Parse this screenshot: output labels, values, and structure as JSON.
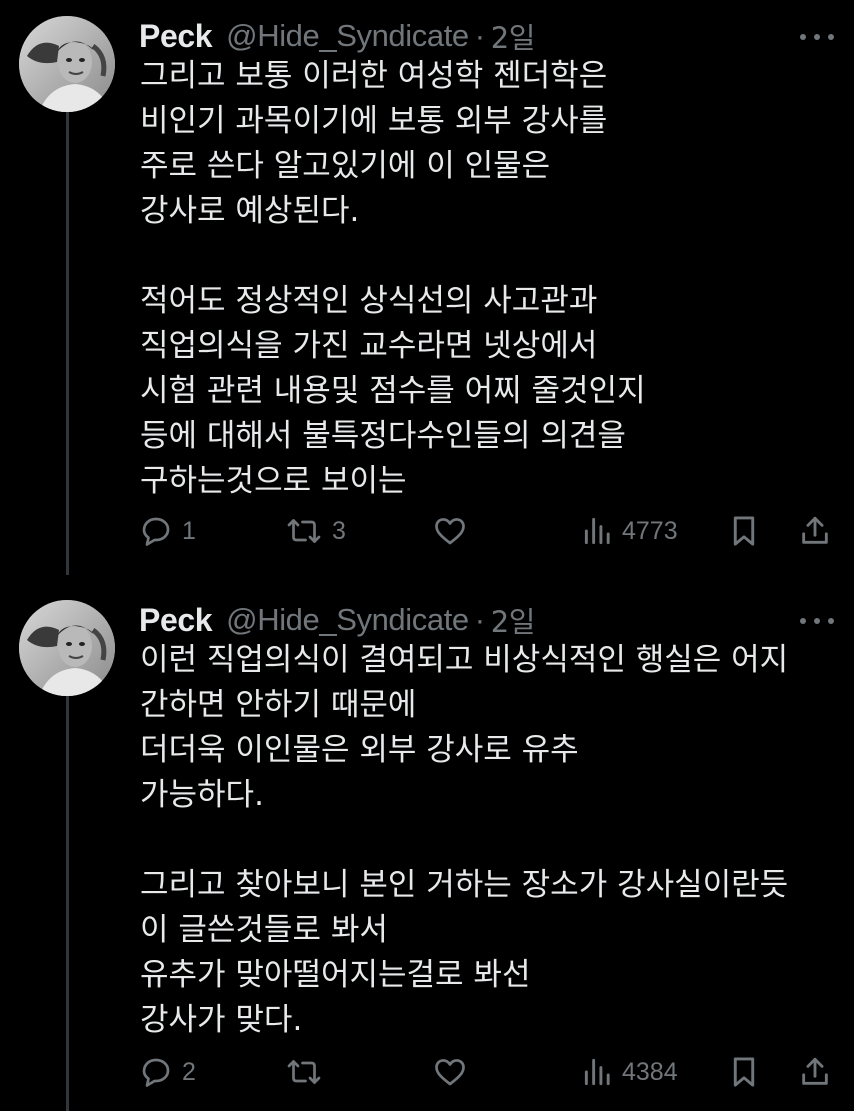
{
  "tweets": [
    {
      "display_name": "Peck",
      "handle": "@Hide_Syndicate",
      "separator": "·",
      "time": "2일",
      "lines": [
        "그리고 보통 이러한 여성학 젠더학은",
        "비인기 과목이기에 보통 외부 강사를",
        "주로 쓴다 알고있기에 이 인물은",
        "강사로 예상된다.",
        "",
        "적어도 정상적인 상식선의 사고관과",
        "직업의식을 가진 교수라면 넷상에서",
        "시험 관련 내용및 점수를 어찌 줄것인지",
        "등에 대해서 불특정다수인들의 의견을",
        "구하는것으로 보이는"
      ],
      "replies": "1",
      "retweets": "3",
      "likes": "",
      "views": "4773"
    },
    {
      "display_name": "Peck",
      "handle": "@Hide_Syndicate",
      "separator": "·",
      "time": "2일",
      "lines": [
        "이런 직업의식이 결여되고 비상식적인 행실은 어지",
        "간하면 안하기 때문에",
        "더더욱 이인물은 외부 강사로 유추",
        "가능하다.",
        "",
        "그리고 찾아보니 본인 거하는 장소가 강사실이란듯",
        "이 글쓴것들로 봐서",
        "유추가 맞아떨어지는걸로 봐선",
        "강사가 맞다."
      ],
      "replies": "2",
      "retweets": "",
      "likes": "",
      "views": "4384"
    }
  ],
  "icons": {
    "reply": "reply-icon",
    "retweet": "retweet-icon",
    "like": "heart-icon",
    "views": "views-icon",
    "bookmark": "bookmark-icon",
    "share": "share-icon",
    "more": "more-icon"
  },
  "colors": {
    "background": "#000000",
    "text": "#e7e9ea",
    "secondary": "#71767b",
    "thread_line": "#333639"
  }
}
